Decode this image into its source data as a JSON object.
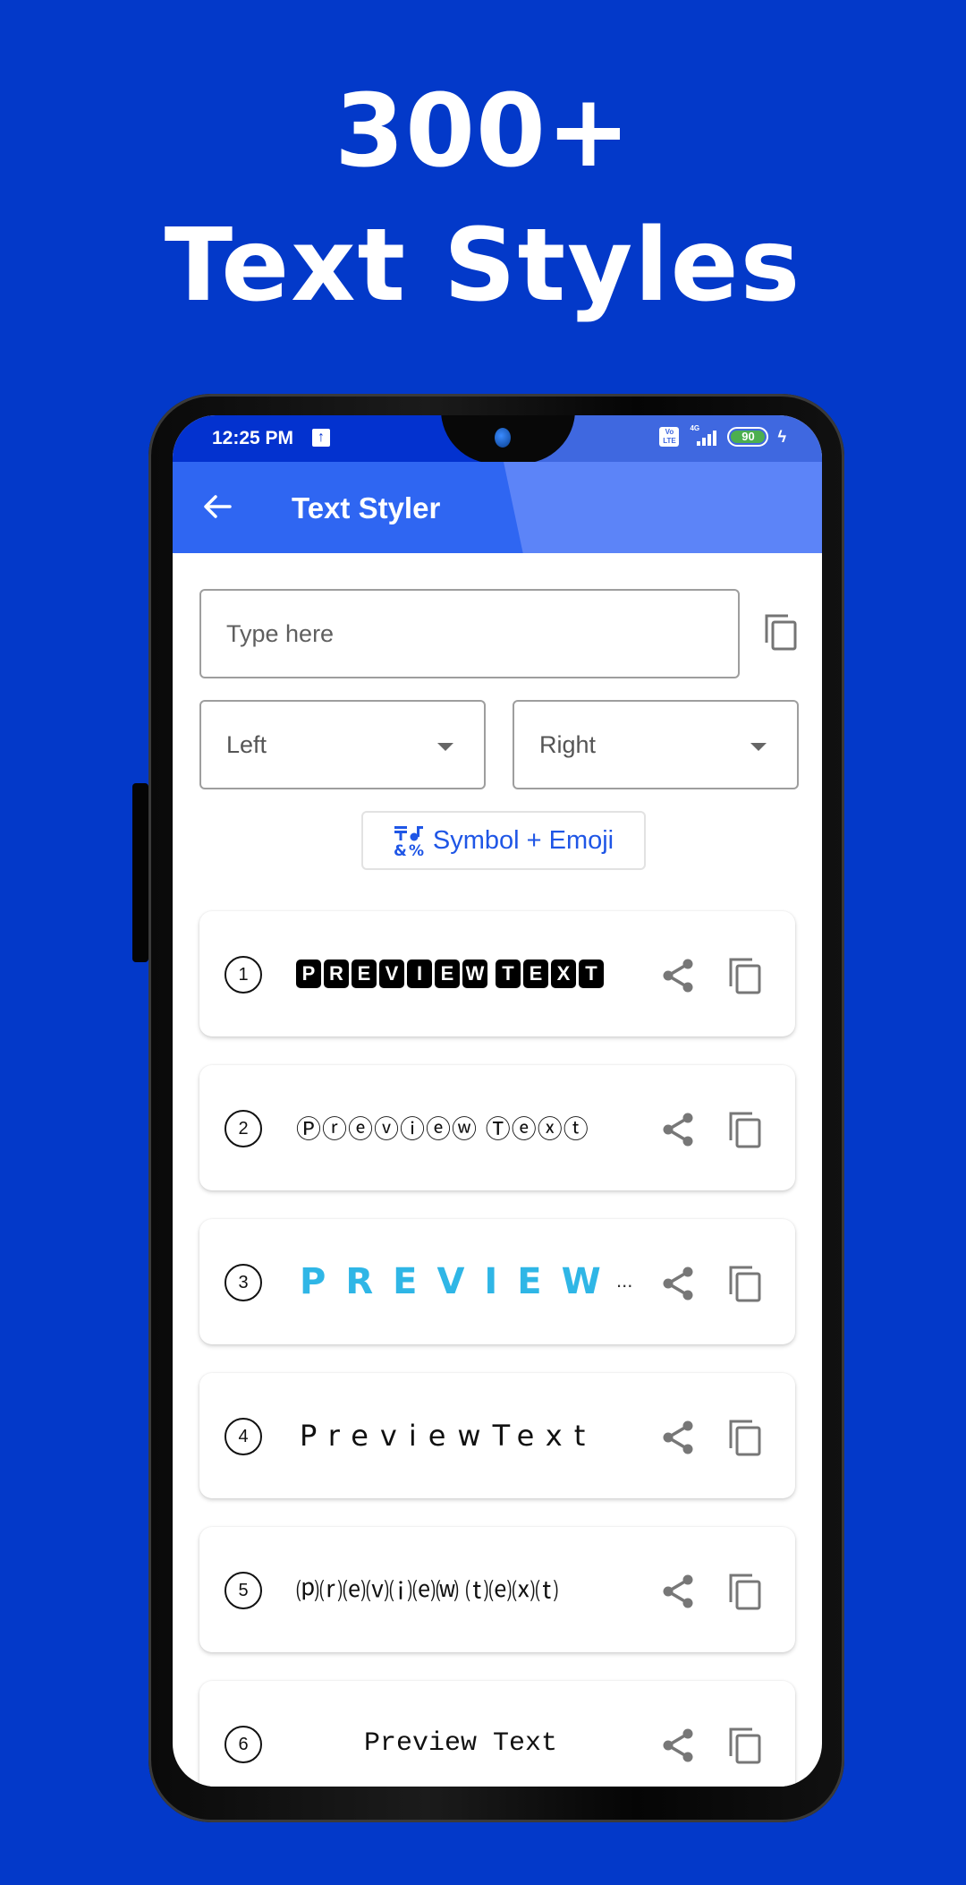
{
  "promo": {
    "headline_line1": "300+",
    "headline_line2": "Text Styles",
    "background_color": "#0339c9"
  },
  "status_bar": {
    "time": "12:25 PM",
    "upload_icon": "upload-icon",
    "volte": "Vo LTE",
    "network": "4G",
    "battery_percent": "90",
    "charging_icon": "bolt-icon"
  },
  "app_bar": {
    "back_icon": "arrow-left-icon",
    "title": "Text Styler",
    "color": "#2f66f2"
  },
  "input": {
    "placeholder": "Type here",
    "value": ""
  },
  "dropdowns": {
    "left": {
      "value": "Left"
    },
    "right": {
      "value": "Right"
    }
  },
  "symbol_button": {
    "label": "Symbol + Emoji",
    "icon": "symbols-icon",
    "icon_glyphs": "T♪&%"
  },
  "styles": [
    {
      "number": "1",
      "preview": "PREVIEW TEXT",
      "style": "black-boxed-letters"
    },
    {
      "number": "2",
      "preview": "Ⓟⓡⓔⓥⓘⓔⓦ Ⓣⓔⓧⓣ",
      "style": "circled-letters"
    },
    {
      "number": "3",
      "preview": "PREVIEW",
      "truncation": "...",
      "style": "spaced-cyan-bold"
    },
    {
      "number": "4",
      "preview": "PreviewText",
      "style": "wide-spaced"
    },
    {
      "number": "5",
      "preview": "⒫⒭⒠⒱⒤⒠⒲ ⒯⒠⒳⒯",
      "style": "parenthesized"
    },
    {
      "number": "6",
      "preview": "Preview Text",
      "style": "typewriter-mono"
    }
  ],
  "row_actions": {
    "share_icon": "share-icon",
    "copy_icon": "copy-icon"
  }
}
